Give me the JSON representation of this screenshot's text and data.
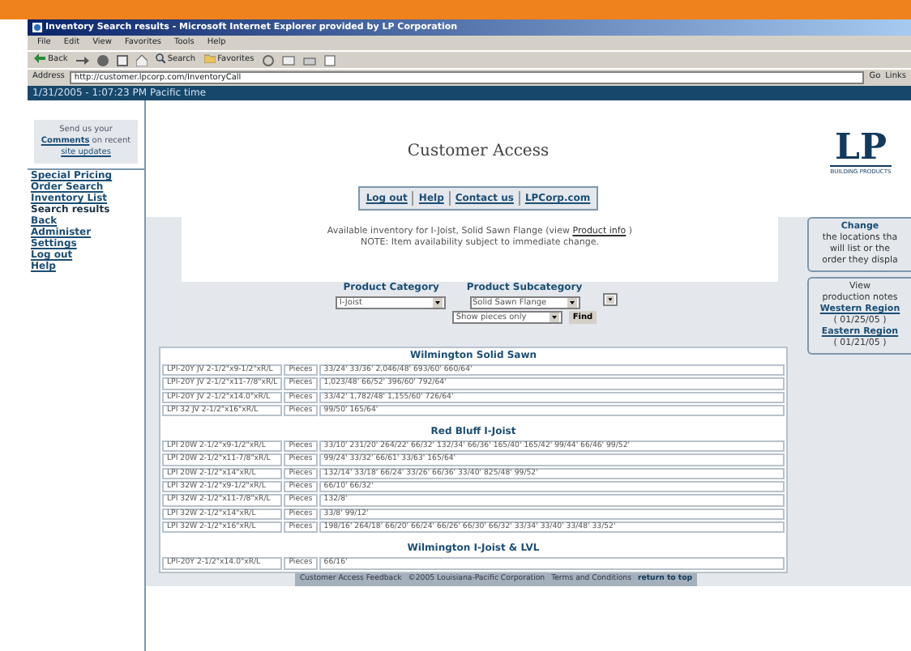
{
  "window": {
    "title": "Inventory Search results - Microsoft Internet Explorer provided by LP Corporation"
  },
  "menu": [
    "File",
    "Edit",
    "View",
    "Favorites",
    "Tools",
    "Help"
  ],
  "toolbar": {
    "back": "Back",
    "search": "Search",
    "favorites": "Favorites"
  },
  "address": {
    "label": "Address",
    "value": "http://customer.lpcorp.com/InventoryCall",
    "go": "Go",
    "links": "Links"
  },
  "date_bar": "1/31/2005 - 1:07:23 PM Pacific time",
  "comments_box": {
    "line_1": "Send us your",
    "link": "Comments",
    "line_2": "on recent",
    "link_2": "site updates"
  },
  "nav": [
    {
      "label": "Special Pricing",
      "selected": false
    },
    {
      "label": "Order Search",
      "selected": false
    },
    {
      "label": "Inventory List",
      "selected": false
    },
    {
      "label": "Search results",
      "selected": true
    },
    {
      "label": "Back",
      "selected": false
    },
    {
      "label": "Administer",
      "selected": false
    },
    {
      "label": "Settings",
      "selected": false
    },
    {
      "label": "Log out",
      "selected": false
    },
    {
      "label": "Help",
      "selected": false
    }
  ],
  "header": {
    "title": "Customer Access",
    "logo": "LP",
    "logo_sub": "BUILDING PRODUCTS"
  },
  "top_links": [
    "Log out",
    "Help",
    "Contact us",
    "LPCorp.com"
  ],
  "notice": {
    "text": "Available inventory for I-Joist, Solid Sawn Flange (view",
    "link": "Product info",
    "end": ")",
    "note": "NOTE: Item availability subject to immediate change."
  },
  "change_box": {
    "title": "Change",
    "lines": [
      "the locations tha",
      "will list or the",
      "order they displa"
    ]
  },
  "notes_box": {
    "line_1": "View",
    "line_2": "production notes",
    "regions": [
      {
        "name": "Western Region",
        "date": "( 01/25/05 )"
      },
      {
        "name": "Eastern Region",
        "date": "( 01/21/05 )"
      }
    ]
  },
  "filters": {
    "category": {
      "label": "Product Category",
      "value": "I-Joist"
    },
    "subcategory": {
      "label": "Product Subcategory",
      "value": "Solid Sawn Flange"
    },
    "show": {
      "value": "Show pieces only"
    },
    "find": "Find"
  },
  "table": {
    "groups": [
      {
        "title": "Wilmington Solid Sawn",
        "rows": [
          {
            "product": "LPI-20Y JV 2-1/2\"x9-1/2\"xR/L",
            "unit": "Pieces",
            "lengths": "33/24' 33/36' 2,046/48' 693/60' 660/64'"
          },
          {
            "product": "LPI-20Y JV 2-1/2\"x11-7/8\"xR/L",
            "unit": "Pieces",
            "lengths": "1,023/48' 66/52' 396/60' 792/64'"
          },
          {
            "product": "LPI-20Y JV 2-1/2\"x14.0\"xR/L",
            "unit": "Pieces",
            "lengths": "33/42' 1,782/48' 1,155/60' 726/64'"
          },
          {
            "product": "LPI 32 JV 2-1/2\"x16\"xR/L",
            "unit": "Pieces",
            "lengths": "99/50' 165/64'"
          }
        ]
      },
      {
        "title": "Red Bluff I-Joist",
        "rows": [
          {
            "product": "LPI 20W 2-1/2\"x9-1/2\"xR/L",
            "unit": "Pieces",
            "lengths": "33/10' 231/20' 264/22' 66/32' 132/34' 66/36' 165/40' 165/42' 99/44' 66/46' 99/52'"
          },
          {
            "product": "LPI 20W 2-1/2\"x11-7/8\"xR/L",
            "unit": "Pieces",
            "lengths": "99/24' 33/32' 66/61' 33/63' 165/64'"
          },
          {
            "product": "LPI 20W 2-1/2\"x14\"xR/L",
            "unit": "Pieces",
            "lengths": "132/14' 33/18' 66/24' 33/26' 66/36' 33/40' 825/48' 99/52'"
          },
          {
            "product": "LPI 32W 2-1/2\"x9-1/2\"xR/L",
            "unit": "Pieces",
            "lengths": "66/10' 66/32'"
          },
          {
            "product": "LPI 32W 2-1/2\"x11-7/8\"xR/L",
            "unit": "Pieces",
            "lengths": "132/8'"
          },
          {
            "product": "LPI 32W 2-1/2\"x14\"xR/L",
            "unit": "Pieces",
            "lengths": "33/8' 99/12'"
          },
          {
            "product": "LPI 32W 2-1/2\"x16\"xR/L",
            "unit": "Pieces",
            "lengths": "198/16' 264/18' 66/20' 66/24' 66/26' 66/30' 66/32' 33/34' 33/40' 33/48' 33/52'"
          }
        ]
      },
      {
        "title": "Wilmington I-Joist & LVL",
        "rows": [
          {
            "product": "LPI-20Y 2-1/2\"x14.0\"xR/L",
            "unit": "Pieces",
            "lengths": "66/16'"
          }
        ]
      }
    ]
  },
  "footer": [
    "Customer Access Feedback",
    "©2005 Louisiana-Pacific Corporation",
    "Terms and Conditions",
    "return to top"
  ]
}
